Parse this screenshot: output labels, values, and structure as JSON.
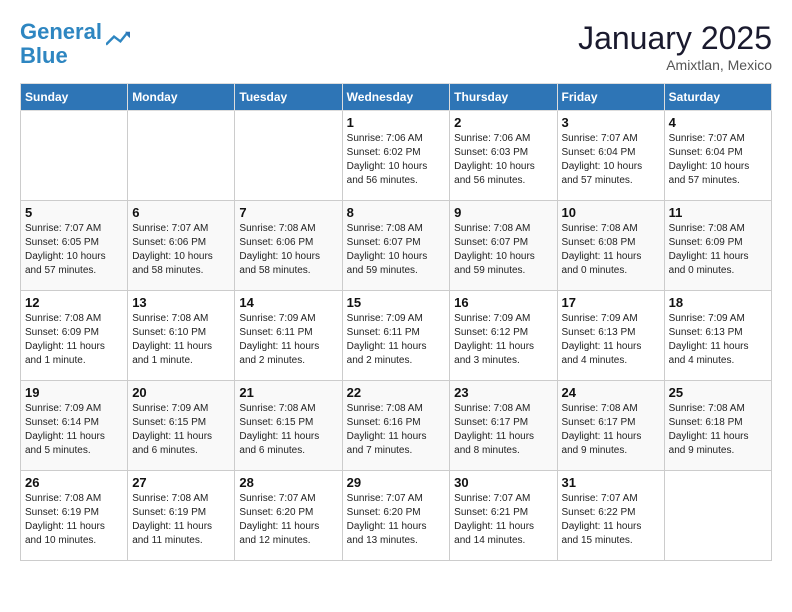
{
  "header": {
    "logo_line1": "General",
    "logo_line2": "Blue",
    "month": "January 2025",
    "location": "Amixtlan, Mexico"
  },
  "weekdays": [
    "Sunday",
    "Monday",
    "Tuesday",
    "Wednesday",
    "Thursday",
    "Friday",
    "Saturday"
  ],
  "weeks": [
    [
      {
        "day": "",
        "sunrise": "",
        "sunset": "",
        "daylight": "",
        "empty": true
      },
      {
        "day": "",
        "sunrise": "",
        "sunset": "",
        "daylight": "",
        "empty": true
      },
      {
        "day": "",
        "sunrise": "",
        "sunset": "",
        "daylight": "",
        "empty": true
      },
      {
        "day": "1",
        "sunrise": "Sunrise: 7:06 AM",
        "sunset": "Sunset: 6:02 PM",
        "daylight": "Daylight: 10 hours and 56 minutes."
      },
      {
        "day": "2",
        "sunrise": "Sunrise: 7:06 AM",
        "sunset": "Sunset: 6:03 PM",
        "daylight": "Daylight: 10 hours and 56 minutes."
      },
      {
        "day": "3",
        "sunrise": "Sunrise: 7:07 AM",
        "sunset": "Sunset: 6:04 PM",
        "daylight": "Daylight: 10 hours and 57 minutes."
      },
      {
        "day": "4",
        "sunrise": "Sunrise: 7:07 AM",
        "sunset": "Sunset: 6:04 PM",
        "daylight": "Daylight: 10 hours and 57 minutes."
      }
    ],
    [
      {
        "day": "5",
        "sunrise": "Sunrise: 7:07 AM",
        "sunset": "Sunset: 6:05 PM",
        "daylight": "Daylight: 10 hours and 57 minutes."
      },
      {
        "day": "6",
        "sunrise": "Sunrise: 7:07 AM",
        "sunset": "Sunset: 6:06 PM",
        "daylight": "Daylight: 10 hours and 58 minutes."
      },
      {
        "day": "7",
        "sunrise": "Sunrise: 7:08 AM",
        "sunset": "Sunset: 6:06 PM",
        "daylight": "Daylight: 10 hours and 58 minutes."
      },
      {
        "day": "8",
        "sunrise": "Sunrise: 7:08 AM",
        "sunset": "Sunset: 6:07 PM",
        "daylight": "Daylight: 10 hours and 59 minutes."
      },
      {
        "day": "9",
        "sunrise": "Sunrise: 7:08 AM",
        "sunset": "Sunset: 6:07 PM",
        "daylight": "Daylight: 10 hours and 59 minutes."
      },
      {
        "day": "10",
        "sunrise": "Sunrise: 7:08 AM",
        "sunset": "Sunset: 6:08 PM",
        "daylight": "Daylight: 11 hours and 0 minutes."
      },
      {
        "day": "11",
        "sunrise": "Sunrise: 7:08 AM",
        "sunset": "Sunset: 6:09 PM",
        "daylight": "Daylight: 11 hours and 0 minutes."
      }
    ],
    [
      {
        "day": "12",
        "sunrise": "Sunrise: 7:08 AM",
        "sunset": "Sunset: 6:09 PM",
        "daylight": "Daylight: 11 hours and 1 minute."
      },
      {
        "day": "13",
        "sunrise": "Sunrise: 7:08 AM",
        "sunset": "Sunset: 6:10 PM",
        "daylight": "Daylight: 11 hours and 1 minute."
      },
      {
        "day": "14",
        "sunrise": "Sunrise: 7:09 AM",
        "sunset": "Sunset: 6:11 PM",
        "daylight": "Daylight: 11 hours and 2 minutes."
      },
      {
        "day": "15",
        "sunrise": "Sunrise: 7:09 AM",
        "sunset": "Sunset: 6:11 PM",
        "daylight": "Daylight: 11 hours and 2 minutes."
      },
      {
        "day": "16",
        "sunrise": "Sunrise: 7:09 AM",
        "sunset": "Sunset: 6:12 PM",
        "daylight": "Daylight: 11 hours and 3 minutes."
      },
      {
        "day": "17",
        "sunrise": "Sunrise: 7:09 AM",
        "sunset": "Sunset: 6:13 PM",
        "daylight": "Daylight: 11 hours and 4 minutes."
      },
      {
        "day": "18",
        "sunrise": "Sunrise: 7:09 AM",
        "sunset": "Sunset: 6:13 PM",
        "daylight": "Daylight: 11 hours and 4 minutes."
      }
    ],
    [
      {
        "day": "19",
        "sunrise": "Sunrise: 7:09 AM",
        "sunset": "Sunset: 6:14 PM",
        "daylight": "Daylight: 11 hours and 5 minutes."
      },
      {
        "day": "20",
        "sunrise": "Sunrise: 7:09 AM",
        "sunset": "Sunset: 6:15 PM",
        "daylight": "Daylight: 11 hours and 6 minutes."
      },
      {
        "day": "21",
        "sunrise": "Sunrise: 7:08 AM",
        "sunset": "Sunset: 6:15 PM",
        "daylight": "Daylight: 11 hours and 6 minutes."
      },
      {
        "day": "22",
        "sunrise": "Sunrise: 7:08 AM",
        "sunset": "Sunset: 6:16 PM",
        "daylight": "Daylight: 11 hours and 7 minutes."
      },
      {
        "day": "23",
        "sunrise": "Sunrise: 7:08 AM",
        "sunset": "Sunset: 6:17 PM",
        "daylight": "Daylight: 11 hours and 8 minutes."
      },
      {
        "day": "24",
        "sunrise": "Sunrise: 7:08 AM",
        "sunset": "Sunset: 6:17 PM",
        "daylight": "Daylight: 11 hours and 9 minutes."
      },
      {
        "day": "25",
        "sunrise": "Sunrise: 7:08 AM",
        "sunset": "Sunset: 6:18 PM",
        "daylight": "Daylight: 11 hours and 9 minutes."
      }
    ],
    [
      {
        "day": "26",
        "sunrise": "Sunrise: 7:08 AM",
        "sunset": "Sunset: 6:19 PM",
        "daylight": "Daylight: 11 hours and 10 minutes."
      },
      {
        "day": "27",
        "sunrise": "Sunrise: 7:08 AM",
        "sunset": "Sunset: 6:19 PM",
        "daylight": "Daylight: 11 hours and 11 minutes."
      },
      {
        "day": "28",
        "sunrise": "Sunrise: 7:07 AM",
        "sunset": "Sunset: 6:20 PM",
        "daylight": "Daylight: 11 hours and 12 minutes."
      },
      {
        "day": "29",
        "sunrise": "Sunrise: 7:07 AM",
        "sunset": "Sunset: 6:20 PM",
        "daylight": "Daylight: 11 hours and 13 minutes."
      },
      {
        "day": "30",
        "sunrise": "Sunrise: 7:07 AM",
        "sunset": "Sunset: 6:21 PM",
        "daylight": "Daylight: 11 hours and 14 minutes."
      },
      {
        "day": "31",
        "sunrise": "Sunrise: 7:07 AM",
        "sunset": "Sunset: 6:22 PM",
        "daylight": "Daylight: 11 hours and 15 minutes."
      },
      {
        "day": "",
        "sunrise": "",
        "sunset": "",
        "daylight": "",
        "empty": true
      }
    ]
  ]
}
